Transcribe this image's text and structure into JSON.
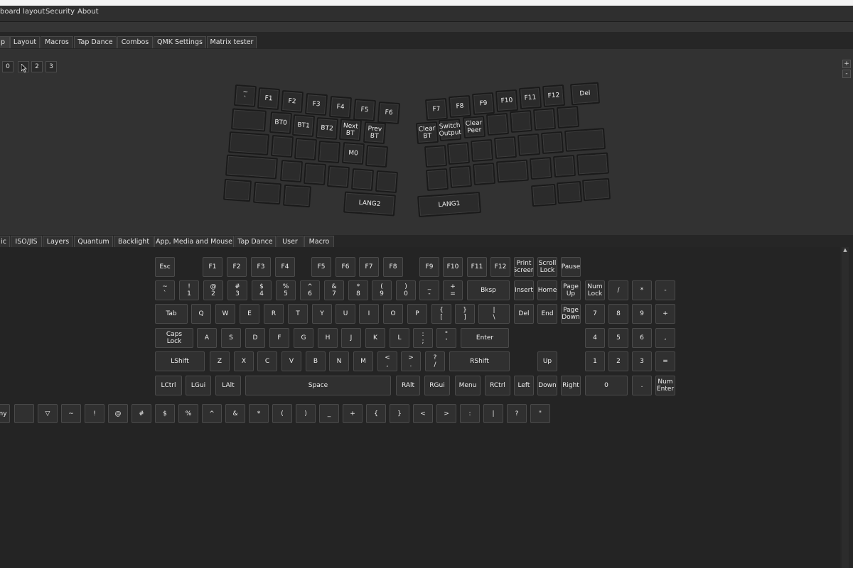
{
  "menu": [
    "board layout",
    "Security",
    "About"
  ],
  "tabs_top": [
    {
      "label": "p",
      "active": true
    },
    {
      "label": "Layout"
    },
    {
      "label": "Macros"
    },
    {
      "label": "Tap Dance"
    },
    {
      "label": "Combos"
    },
    {
      "label": "QMK Settings"
    },
    {
      "label": "Matrix tester"
    }
  ],
  "layers": [
    "0",
    "1",
    "2",
    "3"
  ],
  "side_buttons": [
    "+",
    "-"
  ],
  "split_keyboard": {
    "left": [
      [
        "~\n`",
        "F1",
        "F2",
        "F3",
        "F4",
        "F5",
        "F6"
      ],
      [
        "",
        "BT0",
        "BT1",
        "BT2",
        "Next\nBT",
        "Prev\nBT"
      ],
      [
        "",
        "",
        "",
        "",
        "M0",
        ""
      ],
      [
        "",
        "",
        "",
        "",
        "",
        ""
      ],
      [
        "",
        "",
        "",
        "LANG2"
      ]
    ],
    "right": [
      [
        "F7",
        "F8",
        "F9",
        "F10",
        "F11",
        "F12",
        "Del"
      ],
      [
        "Clear\nBT",
        "Switch\nOutput",
        "Clear\nPeer",
        "",
        "",
        "",
        ""
      ],
      [
        "",
        "",
        "",
        "",
        "",
        "",
        ""
      ],
      [
        "",
        "",
        "",
        "",
        "",
        "",
        ""
      ],
      [
        "LANG1",
        "",
        "",
        ""
      ]
    ]
  },
  "tabs_bottom": [
    {
      "label": "ic"
    },
    {
      "label": "ISO/JIS"
    },
    {
      "label": "Layers"
    },
    {
      "label": "Quantum"
    },
    {
      "label": "Backlight"
    },
    {
      "label": "App, Media and Mouse"
    },
    {
      "label": "Tap Dance"
    },
    {
      "label": "User"
    },
    {
      "label": "Macro"
    }
  ],
  "basic_keys": [
    {
      "t": "Esc"
    },
    {
      "t": "F1"
    },
    {
      "t": "F2"
    },
    {
      "t": "F3"
    },
    {
      "t": "F4"
    },
    {
      "t": "F5"
    },
    {
      "t": "F6"
    },
    {
      "t": "F7"
    },
    {
      "t": "F8"
    },
    {
      "t": "F9"
    },
    {
      "t": "F10"
    },
    {
      "t": "F11"
    },
    {
      "t": "F12"
    },
    {
      "t": "Print\nScreen"
    },
    {
      "t": "Scroll\nLock"
    },
    {
      "t": "Pause"
    },
    {
      "t": "~\n`"
    },
    {
      "t": "!\n1"
    },
    {
      "t": "@\n2"
    },
    {
      "t": "#\n3"
    },
    {
      "t": "$\n4"
    },
    {
      "t": "%\n5"
    },
    {
      "t": "^\n6"
    },
    {
      "t": "&\n7"
    },
    {
      "t": "*\n8"
    },
    {
      "t": "(\n9"
    },
    {
      "t": ")\n0"
    },
    {
      "t": "_\n-"
    },
    {
      "t": "+\n="
    },
    {
      "t": "Bksp"
    },
    {
      "t": "Insert"
    },
    {
      "t": "Home"
    },
    {
      "t": "Page\nUp"
    },
    {
      "t": "Num\nLock"
    },
    {
      "t": "/"
    },
    {
      "t": "*"
    },
    {
      "t": "-"
    },
    {
      "t": "Tab"
    },
    {
      "t": "Q"
    },
    {
      "t": "W"
    },
    {
      "t": "E"
    },
    {
      "t": "R"
    },
    {
      "t": "T"
    },
    {
      "t": "Y"
    },
    {
      "t": "U"
    },
    {
      "t": "I"
    },
    {
      "t": "O"
    },
    {
      "t": "P"
    },
    {
      "t": "{\n["
    },
    {
      "t": "}\n]"
    },
    {
      "t": "|\n\\"
    },
    {
      "t": "Del"
    },
    {
      "t": "End"
    },
    {
      "t": "Page\nDown"
    },
    {
      "t": "7"
    },
    {
      "t": "8"
    },
    {
      "t": "9"
    },
    {
      "t": "+"
    },
    {
      "t": "Caps\nLock"
    },
    {
      "t": "A"
    },
    {
      "t": "S"
    },
    {
      "t": "D"
    },
    {
      "t": "F"
    },
    {
      "t": "G"
    },
    {
      "t": "H"
    },
    {
      "t": "J"
    },
    {
      "t": "K"
    },
    {
      "t": "L"
    },
    {
      "t": ":\n;"
    },
    {
      "t": "\"\n'"
    },
    {
      "t": "Enter"
    },
    {
      "t": "4"
    },
    {
      "t": "5"
    },
    {
      "t": "6"
    },
    {
      "t": ","
    },
    {
      "t": "LShift"
    },
    {
      "t": "Z"
    },
    {
      "t": "X"
    },
    {
      "t": "C"
    },
    {
      "t": "V"
    },
    {
      "t": "B"
    },
    {
      "t": "N"
    },
    {
      "t": "M"
    },
    {
      "t": "<\n,"
    },
    {
      "t": ">\n."
    },
    {
      "t": "?\n/"
    },
    {
      "t": "RShift"
    },
    {
      "t": "Up"
    },
    {
      "t": "1"
    },
    {
      "t": "2"
    },
    {
      "t": "3"
    },
    {
      "t": "="
    },
    {
      "t": "LCtrl"
    },
    {
      "t": "LGui"
    },
    {
      "t": "LAlt"
    },
    {
      "t": "Space"
    },
    {
      "t": "RAlt"
    },
    {
      "t": "RGui"
    },
    {
      "t": "Menu"
    },
    {
      "t": "RCtrl"
    },
    {
      "t": "Left"
    },
    {
      "t": "Down"
    },
    {
      "t": "Right"
    },
    {
      "t": "0"
    },
    {
      "t": "."
    },
    {
      "t": "Num\nEnter"
    }
  ],
  "symbol_keys": [
    "ny",
    "",
    "▽",
    "~",
    "!",
    "@",
    "#",
    "$",
    "%",
    "^",
    "&",
    "*",
    "(",
    ")",
    "_",
    "+",
    "{",
    "}",
    "<",
    ">",
    ":",
    "|",
    "?",
    "\""
  ]
}
